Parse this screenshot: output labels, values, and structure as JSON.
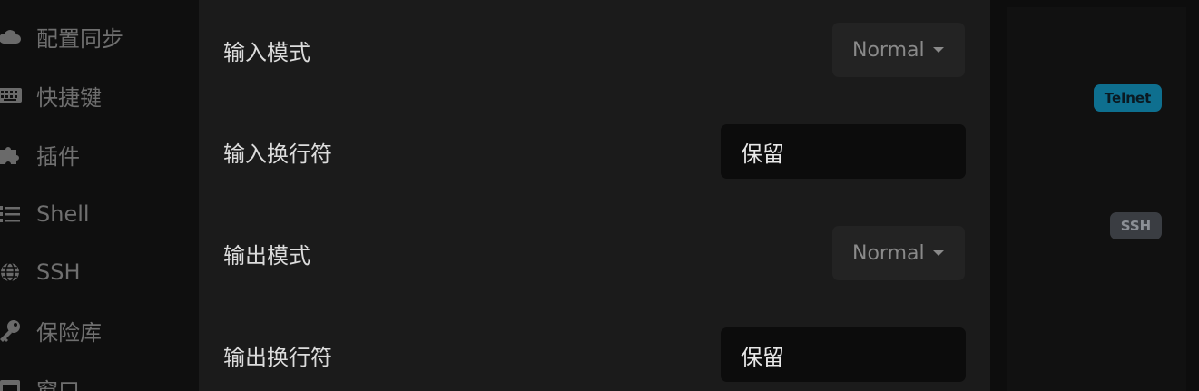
{
  "sidebar": {
    "items": [
      {
        "label": "配置同步",
        "icon": "cloud-icon"
      },
      {
        "label": "快捷键",
        "icon": "keyboard-icon"
      },
      {
        "label": "插件",
        "icon": "puzzle-icon"
      },
      {
        "label": "Shell",
        "icon": "list-icon"
      },
      {
        "label": "SSH",
        "icon": "globe-icon"
      },
      {
        "label": "保险库",
        "icon": "key-icon"
      },
      {
        "label": "窗口",
        "icon": "window-icon"
      }
    ]
  },
  "settings": {
    "input_mode_label": "输入模式",
    "input_mode_value": "Normal",
    "input_newline_label": "输入换行符",
    "input_newline_value": "保留",
    "output_mode_label": "输出模式",
    "output_mode_value": "Normal",
    "output_newline_label": "输出换行符",
    "output_newline_value": "保留"
  },
  "profiles": {
    "telnet_badge": "Telnet",
    "ssh_badge": "SSH"
  },
  "colors": {
    "telnet_badge_bg": "#0e6f8f",
    "ssh_badge_bg": "#3a3d42"
  }
}
